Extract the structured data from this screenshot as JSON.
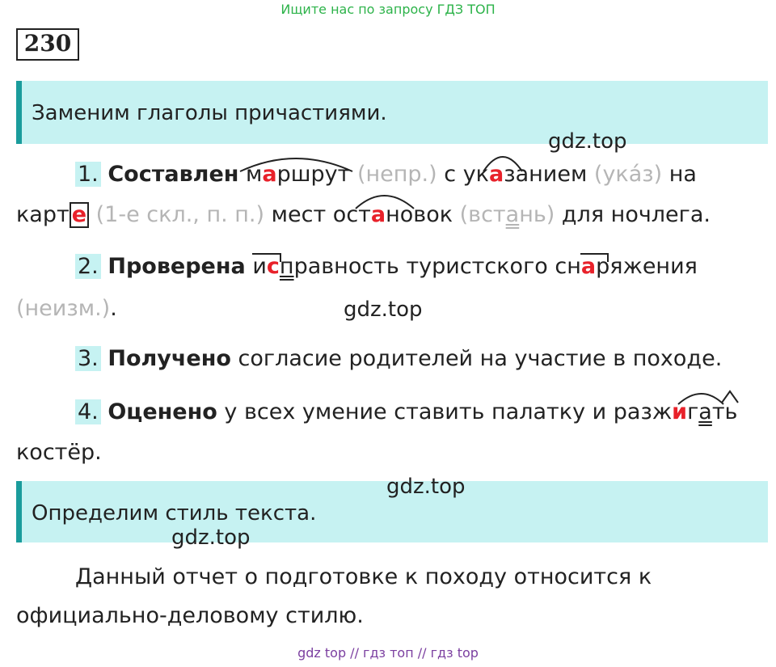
{
  "banner": "Ищите нас по запросу ГДЗ ТОП",
  "exercise_number": "230",
  "section1_title": "Заменим глаголы причастиями.",
  "section2_title": "Определим стиль текста.",
  "watermark": "gdz.top",
  "item1": {
    "num": "1.",
    "verb": "Составлен",
    "w1a": "м",
    "w1b": "а",
    "w1c": "ршрут",
    "note1": "(непр.)",
    "t1": "с",
    "w2a": "ук",
    "w2b": "а",
    "w2c": "занием",
    "note2": "(ука́з)",
    "t2": "на",
    "w3a": "карт",
    "w3b": "е",
    "note3": "(1-е скл., п. п.)",
    "t3": "мест",
    "w4a": "ост",
    "w4b": "а",
    "w4c": "новок",
    "note4a": "(вст",
    "note4b": "а",
    "note4c": "нь)",
    "t4": "для ночлега."
  },
  "item2": {
    "num": "2.",
    "verb": "Проверена",
    "w1a": "и",
    "w1b": "с",
    "w1c": "п",
    "w1d": "равность",
    "t1": "туристского",
    "w2a": "сн",
    "w2b": "а",
    "w2c": "ряжения",
    "note": "(неизм.)",
    "t2": "."
  },
  "item3": {
    "num": "3.",
    "verb": "Получено",
    "rest": "согласие родителей на участие в походе."
  },
  "item4": {
    "num": "4.",
    "verb": "Оценено",
    "t1": "у всех умение ставить палатку и",
    "w1a": "разж",
    "w1b": "и",
    "w1c": "г",
    "w1d": "а",
    "w1e": "ть",
    "t2": "костёр."
  },
  "conclusion": {
    "line1": "Данный отчет о подготовке к походу относится к",
    "line2": "официально-деловому стилю."
  },
  "footer": "gdz top  //  гдз топ  //  гдз top"
}
